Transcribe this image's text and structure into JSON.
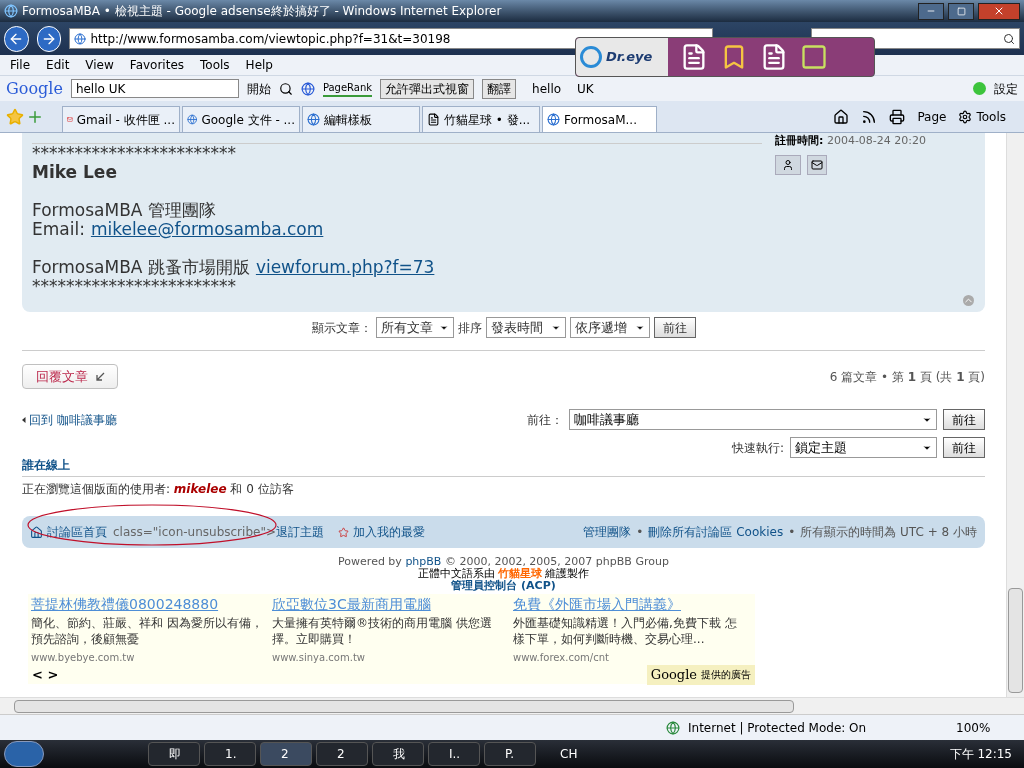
{
  "window": {
    "title": "FormosaMBA • 檢視主題 - Google adsense終於搞好了 - Windows Internet Explorer"
  },
  "address_bar": {
    "url": "http://www.formosamba.com/viewtopic.php?f=31&t=30198"
  },
  "dreye": {
    "name": "Dr.eye"
  },
  "menu": [
    "File",
    "Edit",
    "View",
    "Favorites",
    "Tools",
    "Help"
  ],
  "google_toolbar": {
    "logo": "Google",
    "query": "hello UK",
    "go": "開始",
    "pagerank": "PageRank",
    "popup": "允許彈出式視窗",
    "translate": "翻譯",
    "words": [
      "hello",
      "UK"
    ],
    "settings": "設定"
  },
  "tabs": [
    {
      "label": "Gmail - 收件匣 ...",
      "selected": false,
      "kind": "gmail"
    },
    {
      "label": "Google 文件 - ...",
      "selected": false,
      "kind": "ie"
    },
    {
      "label": "編輯樣板",
      "selected": false,
      "kind": "ie"
    },
    {
      "label": "竹貓星球 • 發...",
      "selected": false,
      "kind": "page"
    },
    {
      "label": "FormosaM...",
      "selected": true,
      "kind": "ie"
    }
  ],
  "command_bar": [
    "Page",
    "Tools"
  ],
  "post": {
    "lines": [
      {
        "kind": "text",
        "text": "************************"
      },
      {
        "kind": "name",
        "text": "Mike Lee"
      },
      {
        "kind": "gap"
      },
      {
        "kind": "text",
        "text": "FormosaMBA 管理團隊"
      },
      {
        "kind": "link",
        "text": "Email:",
        "link": "mikelee@formosamba.com"
      },
      {
        "kind": "gap"
      },
      {
        "kind": "link",
        "text": "FormosaMBA 跳蚤市場開版",
        "link": "viewforum.php?f=73"
      },
      {
        "kind": "text",
        "text": "************************"
      }
    ],
    "registered": {
      "label": "註冊時間:",
      "value": "2004-08-24 20:20"
    }
  },
  "sort": {
    "label": "顯示文章：",
    "display": "所有文章",
    "order_label": "排序",
    "order": "發表時間",
    "direction": "依序遞增",
    "button": "前往"
  },
  "reply_button": "回覆文章",
  "pagination": "6 篇文章 • 第 **1** 頁 (共 **1** 頁)",
  "back_link": "回到 咖啡議事廳",
  "jump": {
    "label": "前往：",
    "value": "咖啡議事廳",
    "button": "前往"
  },
  "quick": {
    "label": "快速執行:",
    "value": "鎖定主題",
    "button": "前往"
  },
  "online": {
    "title": "誰在線上",
    "text": "正在瀏覽這個版面的使用者: **mikelee** 和 0 位訪客"
  },
  "footer_nav": {
    "left": [
      {
        "kind": "home",
        "text": "討論區首頁"
      },
      {
        "kind": "code",
        "text": "class=\"icon-unsubscribe\">"
      },
      {
        "kind": "link",
        "text": "退訂主題"
      },
      {
        "kind": "bookmark",
        "text": "加入我的最愛"
      }
    ],
    "right": [
      {
        "kind": "link",
        "text": "管理團隊"
      },
      {
        "kind": "sep",
        "text": "•"
      },
      {
        "kind": "link",
        "text": "刪除所有討論區 Cookies"
      },
      {
        "kind": "sep",
        "text": "•"
      },
      {
        "kind": "text",
        "text": "所有顯示的時間為 UTC + 8 小時"
      }
    ]
  },
  "credits": {
    "powered": "Powered by **phpBB** © 2000, 2002, 2005, 2007 phpBB Group",
    "translation": "正體中文語系由 **竹貓星球** 維護製作",
    "acp": "管理員控制台 (ACP)"
  },
  "ads": {
    "items": [
      {
        "title": "菩提林佛教禮儀0800248880",
        "text": "簡化、節約、莊嚴、祥和 因為愛所以有備，預先諮詢，後顧無憂",
        "url": "www.byebye.com.tw"
      },
      {
        "title": "欣亞數位3C最新商用電腦",
        "text": "大量擁有英特爾®技術的商用電腦 供您選擇。立即購買！",
        "url": "www.sinya.com.tw"
      },
      {
        "title": "免費《外匯市場入門講義》",
        "text": "外匯基礎知識精選！入門必備,免費下載 怎樣下單，如何判斷時機、交易心理...",
        "url": "www.forex.com/cnt"
      }
    ],
    "nav": "< >",
    "attribution_logo": "Google",
    "attribution": "提供的廣告"
  },
  "status_bar": {
    "zone": "Internet | Protected Mode: On",
    "zoom": "100%"
  },
  "taskbar": {
    "buttons": [
      {
        "label": "即",
        "selected": false
      },
      {
        "label": "1.",
        "selected": false
      },
      {
        "label": "2",
        "selected": true
      },
      {
        "label": "2",
        "selected": false
      },
      {
        "label": "我",
        "selected": false
      },
      {
        "label": "I..",
        "selected": false
      },
      {
        "label": "P.",
        "selected": false
      }
    ],
    "language": "CH",
    "clock": "下午 12:15"
  }
}
